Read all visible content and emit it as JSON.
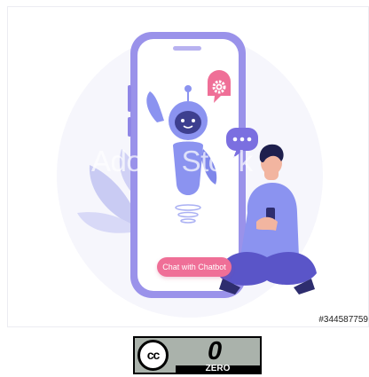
{
  "image": {
    "button_label": "Chat with Chatbot",
    "watermark": "Adobe Stock",
    "stock_id": "#344587759"
  },
  "license_badge": {
    "cc_text": "cc",
    "zero_glyph": "0",
    "zero_label": "ZERO"
  },
  "colors": {
    "phone_frame": "#8f86e6",
    "robot_body": "#8b93f0",
    "pink_bubble": "#ef6f97",
    "purple_bubble": "#7b6fe0",
    "button": "#ef6f97"
  },
  "icons": [
    "gear-icon",
    "ellipsis-icon",
    "robot-illustration",
    "person-illustration",
    "phone-illustration",
    "leaf-illustration"
  ]
}
